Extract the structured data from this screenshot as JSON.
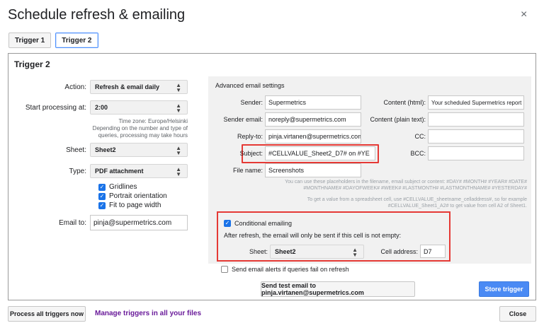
{
  "dialog": {
    "title": "Schedule refresh & emailing",
    "close_glyph": "×"
  },
  "tabs": [
    {
      "label": "Trigger 1"
    },
    {
      "label": "Trigger 2"
    }
  ],
  "panel": {
    "title": "Trigger 2"
  },
  "left": {
    "action": {
      "label": "Action:",
      "value": "Refresh & email daily"
    },
    "start": {
      "label": "Start processing at:",
      "value": "2:00"
    },
    "timezone_note": {
      "line1": "Time zone: Europe/Helsinki",
      "line2": "Depending on the number and type of",
      "line3": "queries, processing may take hours"
    },
    "sheet": {
      "label": "Sheet:",
      "value": "Sheet2"
    },
    "type": {
      "label": "Type:",
      "value": "PDF attachment"
    },
    "checks": [
      {
        "label": "Gridlines"
      },
      {
        "label": "Portrait orientation"
      },
      {
        "label": "Fit to page width"
      }
    ],
    "email_to": {
      "label": "Email to:",
      "value": "pinja@supermetrics.com"
    }
  },
  "advanced": {
    "title": "Advanced email settings",
    "sender": {
      "label": "Sender:",
      "value": "Supermetrics"
    },
    "sender_email": {
      "label": "Sender email:",
      "value": "noreply@supermetrics.com"
    },
    "reply_to": {
      "label": "Reply-to:",
      "value": "pinja.virtanen@supermetrics.com"
    },
    "subject": {
      "label": "Subject:",
      "value": "#CELLVALUE_Sheet2_D7# on #YE"
    },
    "file_name": {
      "label": "File name:",
      "value": "Screenshots"
    },
    "content_html": {
      "label": "Content (html):",
      "value": "Your scheduled Supermetrics report"
    },
    "content_plain": {
      "label": "Content (plain text):",
      "value": ""
    },
    "cc": {
      "label": "CC:",
      "value": ""
    },
    "bcc": {
      "label": "BCC:",
      "value": ""
    },
    "help1": {
      "line1": "You can use these placeholders in the filename, email subject or content: #DAY# #MONTH# #YEAR# #DATE#",
      "line2": "#MONTHNAME# #DAYOFWEEK# #WEEK# #LASTMONTH# #LASTMONTHNAME# #YESTERDAY#"
    },
    "help2": {
      "line1": "To get a value from a spreadsheet cell, use #CELLVALUE_sheetname_celladdress#, so for example",
      "line2": "#CELLVALUE_Sheet1_A2# to get value from cell A2 of Sheet1."
    },
    "conditional": {
      "label": "Conditional emailing",
      "description": "After refresh, the email will only be sent if this cell is not empty:",
      "sheet_label": "Sheet:",
      "sheet_value": "Sheet2",
      "cell_label": "Cell address:",
      "cell_value": "D7"
    }
  },
  "alerts": {
    "label": "Send email alerts if queries fail on refresh"
  },
  "buttons": {
    "send_test": "Send test email to pinja.virtanen@supermetrics.com",
    "store": "Store trigger",
    "process_all": "Process all triggers now",
    "manage": "Manage triggers in all your files",
    "close": "Close"
  },
  "colors": {
    "accent": "#4a8af4",
    "highlight": "#e53935",
    "checkbox": "#1a73e8",
    "link": "#6a1b9a"
  }
}
